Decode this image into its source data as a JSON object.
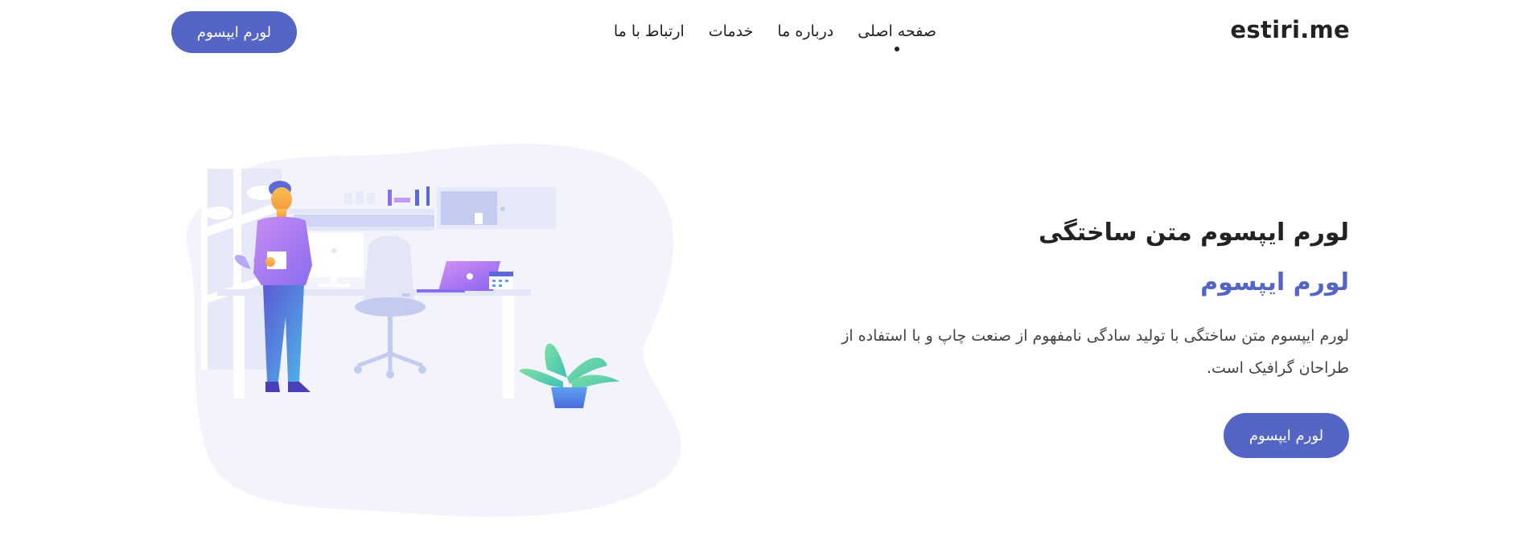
{
  "header": {
    "logo": "estiri.me",
    "nav": [
      {
        "label": "صفحه اصلی",
        "active": true
      },
      {
        "label": "درباره ما",
        "active": false
      },
      {
        "label": "خدمات",
        "active": false
      },
      {
        "label": "ارتباط با ما",
        "active": false
      }
    ],
    "cta_label": "لورم ایپسوم"
  },
  "hero": {
    "title": "لورم ایپسوم متن ساختگی",
    "subtitle": "لورم ایپسوم",
    "description": "لورم ایپسوم متن ساختگی با تولید سادگی نامفهوم از صنعت چاپ و با استفاده از طراحان گرافیک است.",
    "cta_label": "لورم ایپسوم"
  },
  "colors": {
    "accent": "#5565c5",
    "text": "#222222",
    "blob": "#f3f4fb"
  }
}
